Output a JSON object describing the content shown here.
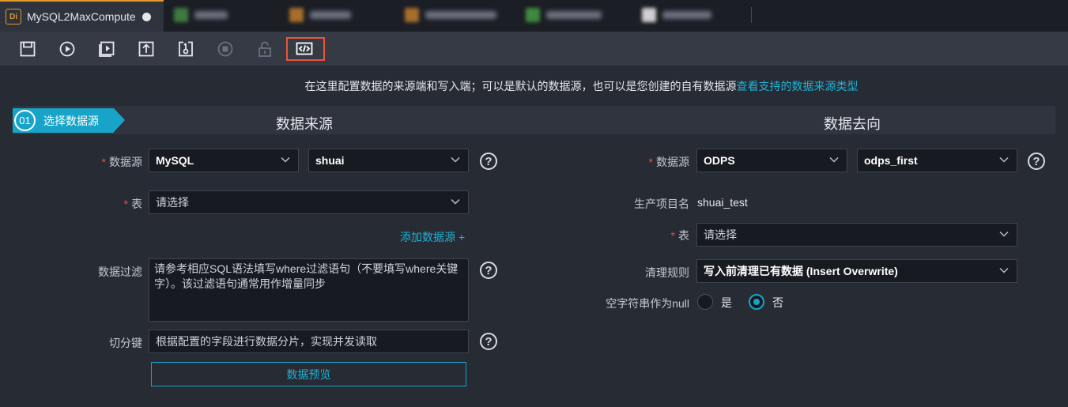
{
  "tabs": {
    "active_badge": "Di",
    "active_title": "MySQL2MaxCompute",
    "blurred_icon_colors": [
      "#3f7a3f",
      "#a86e2a",
      "#a86e2a",
      "#3f8a3f",
      "#d0d0d0"
    ]
  },
  "toolbar": {
    "items": [
      "save-icon",
      "run-icon",
      "run-with-params-icon",
      "submit-icon",
      "publish-icon",
      "stop-icon",
      "lock-icon",
      "script-mode-icon"
    ]
  },
  "info": {
    "text": "在这里配置数据的来源端和写入端；可以是默认的数据源，也可以是您创建的自有数据源",
    "link": "查看支持的数据来源类型"
  },
  "step": {
    "number": "01",
    "label": "选择数据源"
  },
  "source": {
    "title": "数据来源",
    "datasource_label": "数据源",
    "datasource_type": "MySQL",
    "datasource_name": "shuai",
    "table_label": "表",
    "table_placeholder": "请选择",
    "add_datasource": "添加数据源 +",
    "filter_label": "数据过滤",
    "filter_placeholder": "请参考相应SQL语法填写where过滤语句（不要填写where关键字）。该过滤语句通常用作增量同步",
    "split_label": "切分键",
    "split_placeholder": "根据配置的字段进行数据分片，实现并发读取",
    "preview_button": "数据预览"
  },
  "target": {
    "title": "数据去向",
    "datasource_label": "数据源",
    "datasource_type": "ODPS",
    "datasource_name": "odps_first",
    "project_label": "生产项目名",
    "project_value": "shuai_test",
    "table_label": "表",
    "table_placeholder": "请选择",
    "clean_label": "清理规则",
    "clean_value": "写入前清理已有数据 (Insert Overwrite)",
    "null_label": "空字符串作为null",
    "null_yes": "是",
    "null_no": "否",
    "null_selected": "否"
  },
  "help_symbol": "?",
  "required_mark": "*"
}
